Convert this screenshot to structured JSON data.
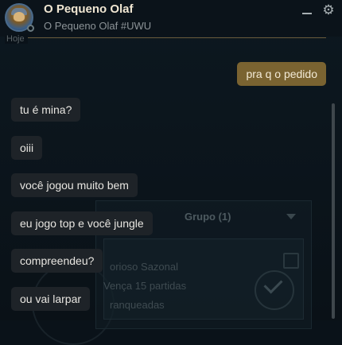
{
  "header": {
    "title": "O Pequeno Olaf",
    "subtitle": "O Pequeno Olaf #UWU",
    "settings_icon": "⚙"
  },
  "chat": {
    "date_label": "Hoje",
    "messages": [
      {
        "from": "me",
        "text": "pra q o pedido"
      },
      {
        "from": "friend",
        "text": "tu é mina?"
      },
      {
        "from": "friend",
        "text": "oiii"
      },
      {
        "from": "friend",
        "text": "você jogou muito bem"
      },
      {
        "from": "friend",
        "text": "eu jogo top e você jungle"
      },
      {
        "from": "friend",
        "text": "compreendeu?"
      },
      {
        "from": "friend",
        "text": "ou vai larpar"
      }
    ]
  },
  "background": {
    "group_label": "Grupo (1)",
    "card_lines": [
      "orioso Sazonal",
      "Vença 15 partidas",
      "ranqueadas"
    ]
  },
  "colors": {
    "outgoing_bubble": "#7a6331",
    "incoming_bubble": "#1e2328",
    "divider_gold": "#6a5b3a",
    "title_text": "#f0e6d2"
  }
}
